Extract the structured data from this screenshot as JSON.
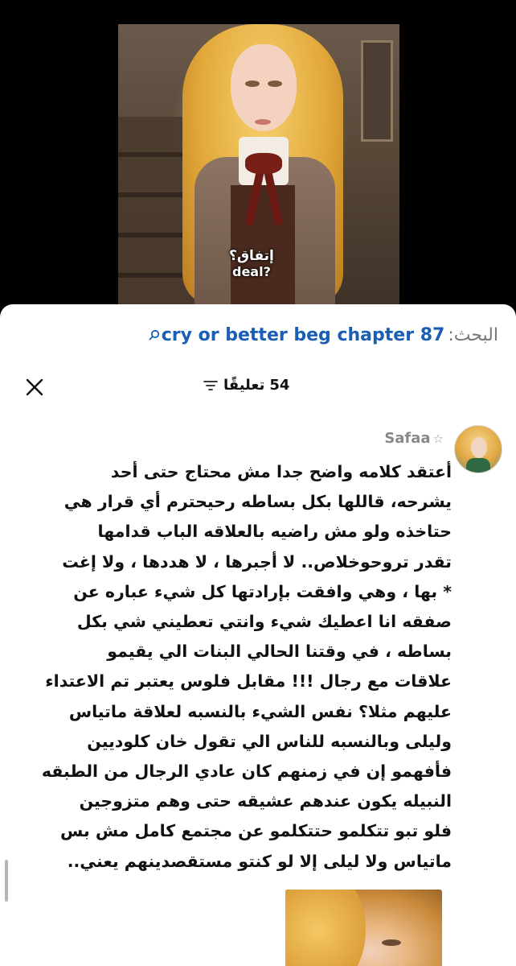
{
  "panel": {
    "speech_arabic": "إتفاق؟",
    "speech_english": "deal?"
  },
  "search": {
    "label": "البحث:",
    "query": "cry or better beg chapter 87",
    "icon": "search-icon",
    "accent_color": "#1a5fb4"
  },
  "comments_header": {
    "count": "54",
    "label": "تعليقًا",
    "filter_icon": "filter-icon",
    "close_icon": "close-icon"
  },
  "comment": {
    "username": "Safaa",
    "badge_icon": "star-icon",
    "lines": [
      "أعتقد كلامه واضح جدا مش محتاج حتى أحد",
      "يشرحه، قاللها بكل بساطه رحيحترم أي قرار هي",
      "حتاخذه ولو مش راضيه بالعلاقه الباب قدامها",
      "تقدر تروحوخلاص.. لا أجبرها ، لا هددها ، ولا إغت",
      "* بها ، وهي وافقت بإرادتها كل شيء عباره عن",
      "صفقه انا اعطيك شيء وانتي تعطيني شي بكل",
      "بساطه ، في وقتنا الحالي البنات الي يقيمو",
      "علاقات مع رجال !!! مقابل فلوس يعتبر تم الاعتداء",
      "عليهم مثلا؟ نفس الشيء بالنسبه لعلاقة ماتياس",
      "وليلى وبالنسبه للناس الي تقول خان كلوديين",
      "فأفهمو إن في زمنهم كان عادي الرجال من الطبقه",
      "النبيله يكون عندهم عشيقه حتى وهم متزوجين",
      "فلو تبو تتكلمو حتتكلمو عن مجتمع كامل مش بس",
      "ماتياس ولا ليلى إلا لو كنتو مستقصدينهم يعني.."
    ]
  }
}
